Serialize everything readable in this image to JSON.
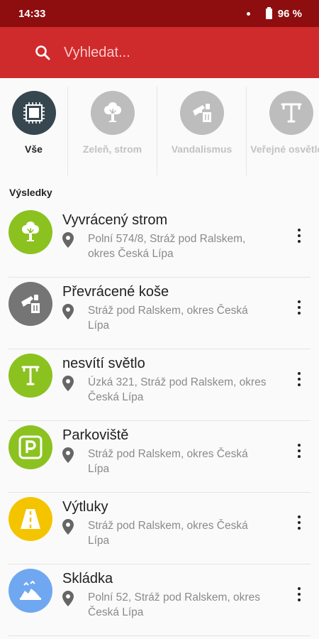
{
  "status": {
    "time": "14:33",
    "battery": "96 %"
  },
  "search": {
    "placeholder": "Vyhledat..."
  },
  "categories": [
    {
      "label": "Vše",
      "icon": "all-icon",
      "active": true
    },
    {
      "label": "Zeleň, strom",
      "icon": "tree-icon"
    },
    {
      "label": "Vandalismus",
      "icon": "vandal-icon"
    },
    {
      "label": "Veřejné osvětlení",
      "icon": "streetlight-icon"
    }
  ],
  "results_title": "Výsledky",
  "results": [
    {
      "title": "Vyvrácený strom",
      "address": "Polní 574/8, Stráž pod Ralskem, okres Česká Lípa",
      "icon": "tree-icon",
      "color": "#8bc220"
    },
    {
      "title": "Převrácené koše",
      "address": "Stráž pod Ralskem, okres Česká Lípa",
      "icon": "vandal-icon",
      "color": "#757575"
    },
    {
      "title": "nesvítí světlo",
      "address": "Úzká 321, Stráž pod Ralskem, okres Česká Lípa",
      "icon": "streetlight-icon",
      "color": "#8bc220"
    },
    {
      "title": "Parkoviště",
      "address": "Stráž pod Ralskem, okres Česká Lípa",
      "icon": "parking-icon",
      "color": "#8bc220"
    },
    {
      "title": "Výtluky",
      "address": "Stráž pod Ralskem, okres Česká Lípa",
      "icon": "road-icon",
      "color": "#f5c400"
    },
    {
      "title": "Skládka",
      "address": "Polní 52, Stráž pod Ralskem, okres Česká Lípa",
      "icon": "dump-icon",
      "color": "#6fa8f0"
    }
  ],
  "colors": {
    "statusbar": "#8e0d0f",
    "appbar": "#cf2a2c",
    "green": "#8bc220",
    "gray": "#757575",
    "yellow": "#f5c400",
    "blue": "#6fa8f0",
    "dark": "#37474f"
  }
}
